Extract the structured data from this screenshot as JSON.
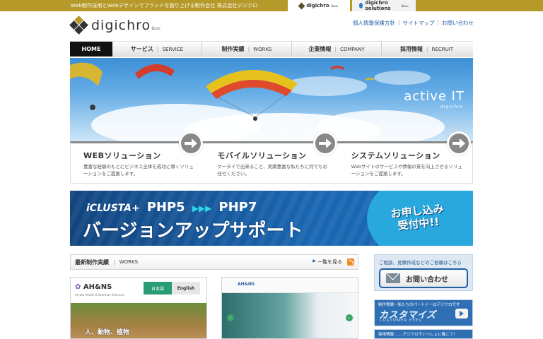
{
  "topbar": {
    "tagline": "Web制作技術とWebデザインでブランドを創り上げる制作会社 株式会社デジクロ",
    "tabs": [
      {
        "label": "digichro",
        "suffix": "&co."
      },
      {
        "label": "digichro solutions",
        "suffix": "&co."
      }
    ]
  },
  "logo": {
    "word": "digichro",
    "suffix": "&co."
  },
  "utility_links": [
    "個人情報保護方針",
    "サイトマップ",
    "お問い合わせ"
  ],
  "nav": [
    {
      "label": "HOME"
    },
    {
      "jp": "サービス",
      "en": "SERVICE"
    },
    {
      "jp": "制作実績",
      "en": "WORKS"
    },
    {
      "jp": "企業情報",
      "en": "COMPANY"
    },
    {
      "jp": "採用情報",
      "en": "RECRUIT"
    }
  ],
  "hero": {
    "headline": "active IT",
    "sub": "digichro"
  },
  "solutions": [
    {
      "title": "WEBソリューション",
      "desc": "豊富な経験のもとにビジネス全体を成功に導くソリューションをご提案します。"
    },
    {
      "title": "モバイルソリューション",
      "desc": "ケータイで出来ること、実績豊富な私たちに何でもお任せください。"
    },
    {
      "title": "システムソリューション",
      "desc": "Webサイトのサービスや情報の質を向上させるソリューションをご提案します。"
    }
  ],
  "banner": {
    "brand": "iCLUSTA+",
    "from": "PHP5",
    "chevrons": "▶▶▶",
    "to": "PHP7",
    "headline": "バージョンアップサポート",
    "cta_line1": "お申し込み",
    "cta_line2": "受付中!!"
  },
  "works": {
    "title_jp": "最新制作実績",
    "title_en": "WORKS",
    "more": "一覧を見る",
    "items": [
      {
        "logo": "AH&NS",
        "subtitle": "Aryata Health & Nutrition Sciences",
        "lang_ja": "日本語",
        "lang_en": "English",
        "catch": "人、動物、植物"
      },
      {
        "logo": "AH&NS",
        "prev": "‹",
        "next": "›"
      }
    ]
  },
  "sidebar": {
    "contact_label": "ご相談、見積作成などのご依頼はこちら",
    "contact_button": "お問い合わせ",
    "customize_caption": "制作実績・私たちのパートナーはデジクロです",
    "customize_big": "カスタマイズ",
    "customize_small": "CUSTOMER EYES",
    "recruit_caption": "採用情報 ……デジクロでいっしょに働こう！"
  },
  "colors": {
    "gold": "#b59a2a",
    "nav_active": "#111111",
    "link": "#1e5fa8",
    "banner_blue": "#1a66b1"
  }
}
